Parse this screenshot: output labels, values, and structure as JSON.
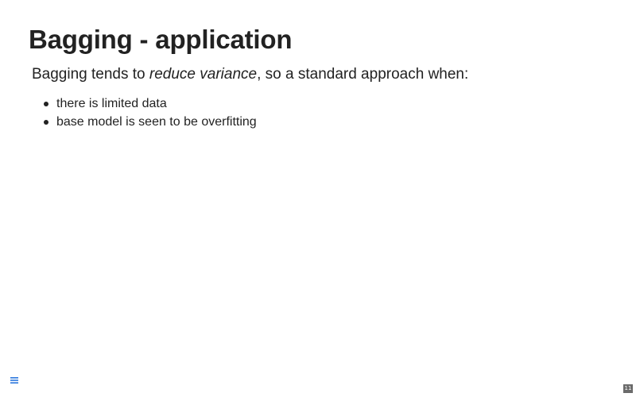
{
  "slide": {
    "title": "Bagging - application",
    "intro": {
      "before": "Bagging tends to ",
      "emphasis": "reduce variance",
      "after": ", so a standard approach when:"
    },
    "bullets": [
      "there is limited data",
      "base model is seen to be overfitting"
    ]
  },
  "controls": {
    "menu_icon": "hamburger-menu-icon",
    "menu_color": "#2a76dd",
    "slide_number": "11"
  }
}
